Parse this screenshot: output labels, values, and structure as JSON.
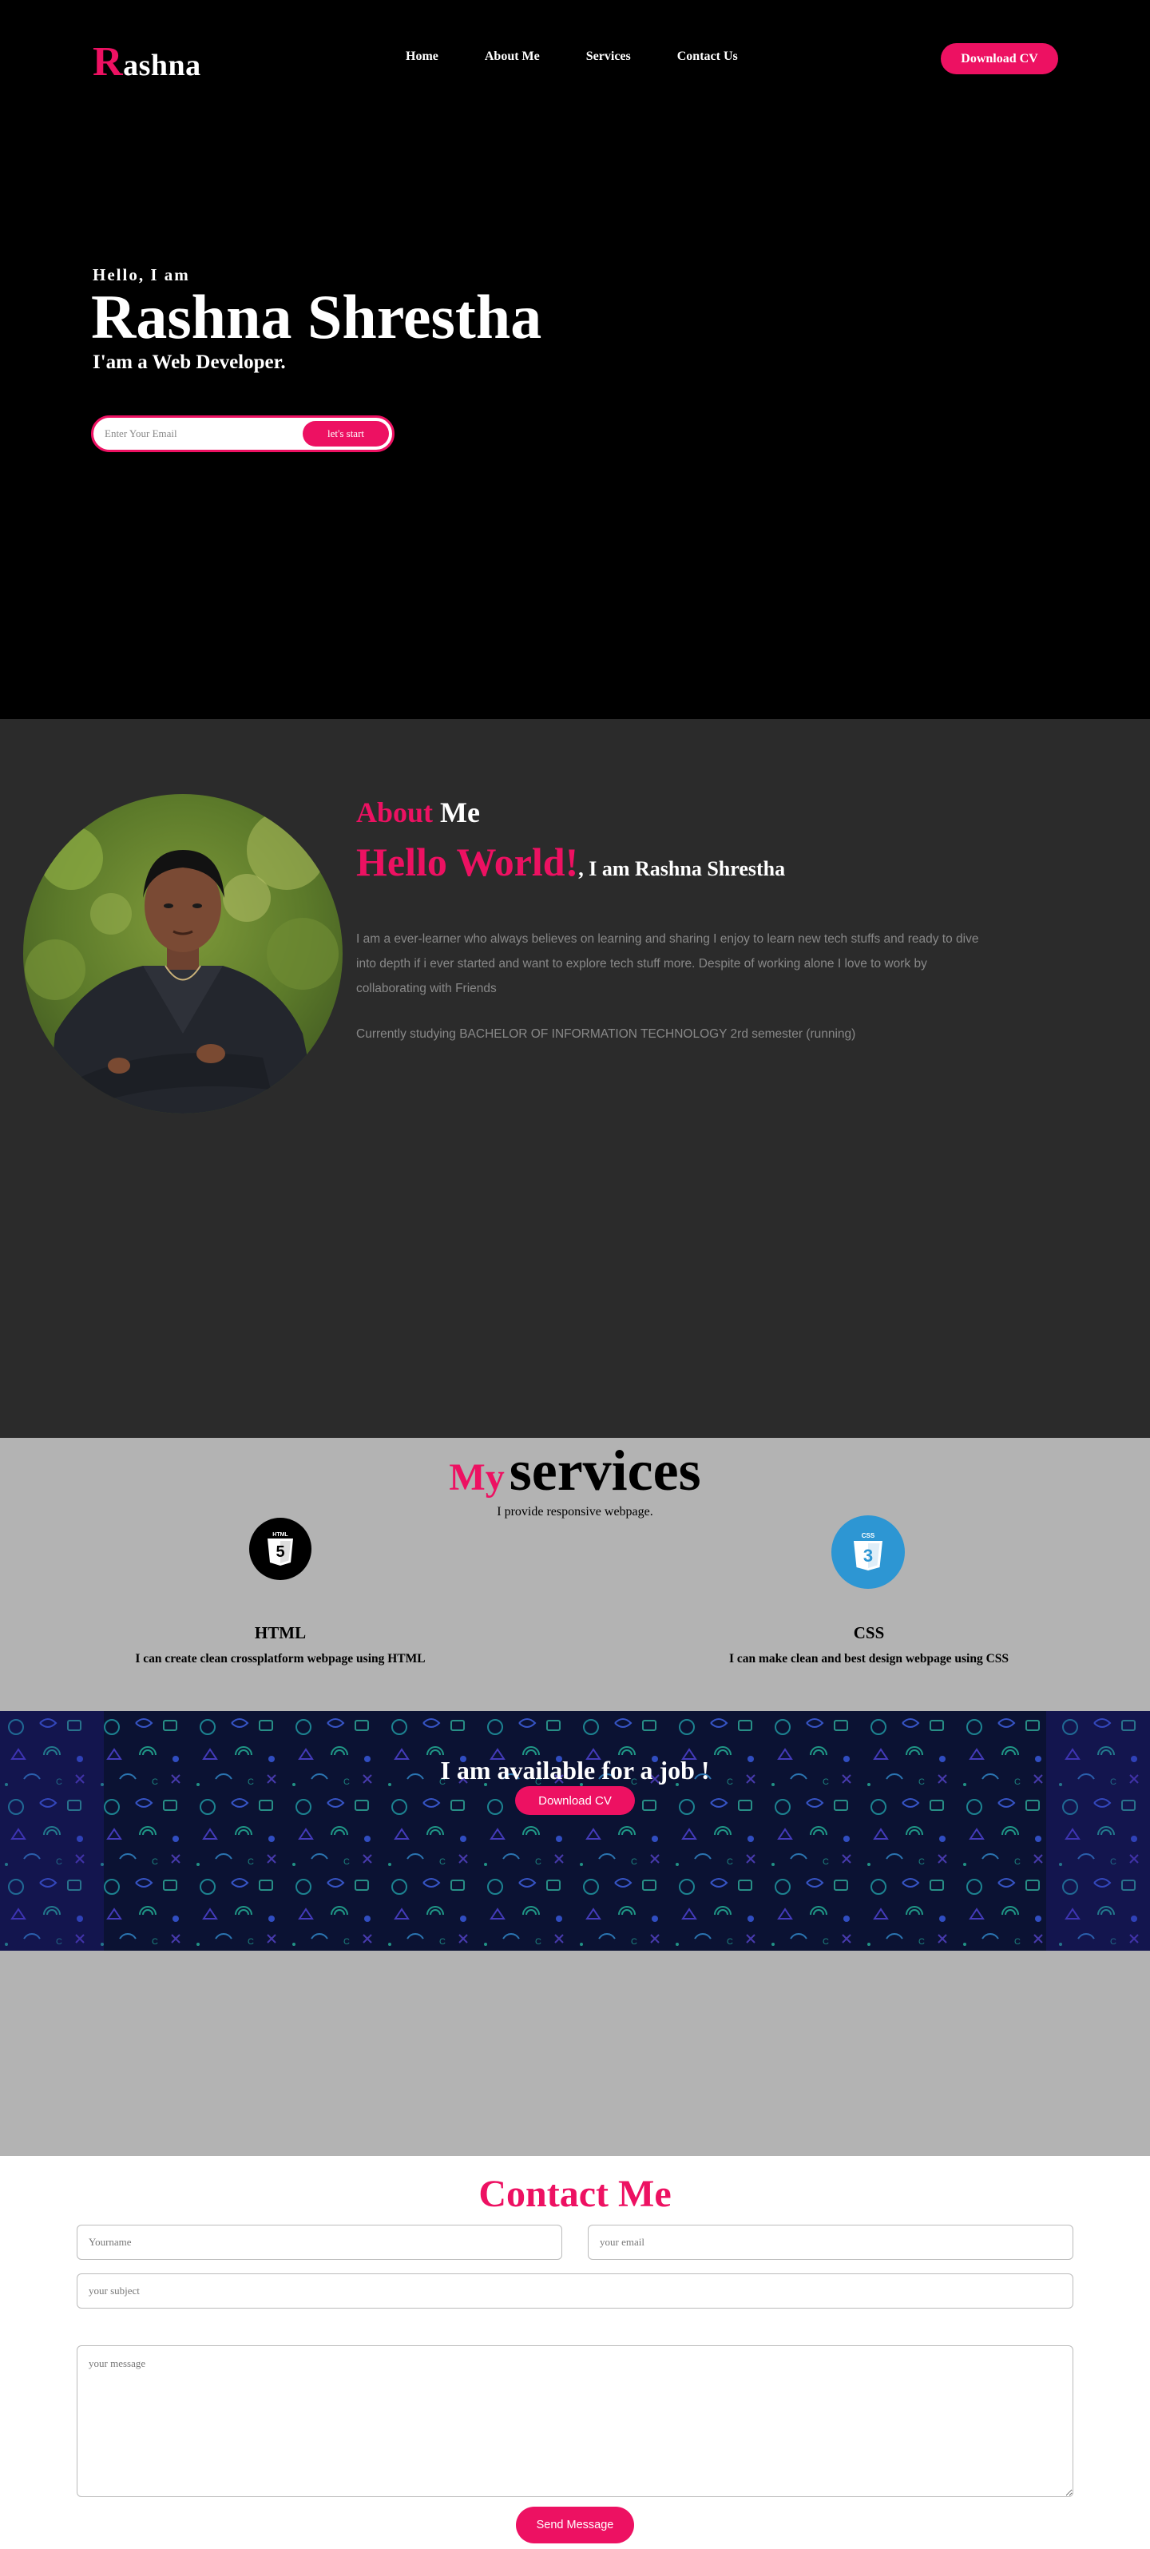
{
  "brand": {
    "first_letter": "R",
    "rest": "ashna",
    "accent": "#ed1162"
  },
  "nav": {
    "items": [
      {
        "label": "Home"
      },
      {
        "label": "About Me"
      },
      {
        "label": "Services"
      },
      {
        "label": "Contact Us"
      }
    ],
    "download_label": "Download CV"
  },
  "hero": {
    "greeting": "Hello, I am",
    "name": "Rashna Shrestha",
    "role": "I'am a Web Developer.",
    "email_placeholder": "Enter Your Email",
    "cta_label": "let's start"
  },
  "about": {
    "title_accent": "About",
    "title_rest": " Me",
    "hello": "Hello World!",
    "intro": ", I am Rashna Shrestha",
    "paragraph": "I am a ever-learner who always believes on learning and sharing I enjoy to learn new tech stuffs and ready to dive into depth if i ever started and want to explore tech stuff more. Despite of working alone I love to work by collaborating with Friends",
    "study": "Currently studying BACHELOR OF INFORMATION TECHNOLOGY 2rd semester (running)"
  },
  "services": {
    "title_accent": "My",
    "title_rest": "services",
    "subtitle": "I provide responsive webpage.",
    "items": [
      {
        "name": "HTML",
        "icon": "html5-icon",
        "description": "I can create clean crossplatform webpage using HTML",
        "badge": "HTML"
      },
      {
        "name": "CSS",
        "icon": "css3-icon",
        "description": "I can make clean and best design webpage using CSS",
        "badge": "CSS"
      }
    ]
  },
  "job": {
    "title": "I am available for a job !",
    "button_label": "Download CV"
  },
  "contact": {
    "title": "Contact Me",
    "name_placeholder": "Yourname",
    "email_placeholder": "your email",
    "subject_placeholder": "your subject",
    "message_placeholder": "your message",
    "send_label": "Send Message"
  }
}
